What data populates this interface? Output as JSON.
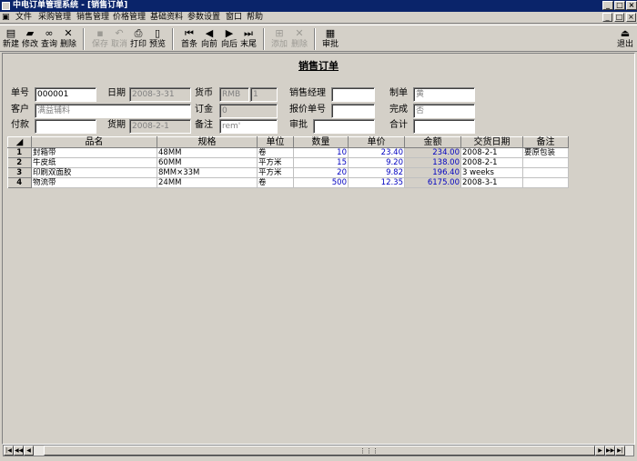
{
  "window": {
    "title": "中电订单管理系统 - [销售订单]",
    "minimize": "_",
    "restore": "□",
    "close": "×"
  },
  "mdi": {
    "minimize": "_",
    "restore": "□",
    "close": "×"
  },
  "menu": [
    "文件",
    "采购管理",
    "销售管理",
    "价格管理",
    "基础资料",
    "参数设置",
    "窗口",
    "帮助"
  ],
  "toolbar": {
    "new": "新建",
    "edit": "修改",
    "query": "查询",
    "delete": "删除",
    "save": "保存",
    "cancel": "取消",
    "print": "打印",
    "preview": "预览",
    "first": "首条",
    "prev": "向前",
    "next": "向后",
    "last": "末尾",
    "add": "添加",
    "remove": "删除",
    "approve": "审批",
    "exit": "退出"
  },
  "form": {
    "title": "销售订单",
    "order_no_label": "单号",
    "order_no": "000001",
    "date_label": "日期",
    "date": "2008-3-31",
    "currency_label": "货币",
    "currency": "RMB",
    "rate": "1",
    "manager_label": "销售经理",
    "manager": "",
    "maker_label": "制单",
    "maker": "黄",
    "customer_label": "客户",
    "customer": "满益辅料",
    "deposit_label": "订金",
    "deposit": "0",
    "quote_no_label": "报价单号",
    "quote_no": "",
    "done_label": "完成",
    "done": "否",
    "payment_label": "付款",
    "payment": "",
    "delivery_label": "货期",
    "delivery": "2008-2-1",
    "remark_label": "备注",
    "remark": "rem'",
    "approval_label": "审批",
    "approval": "",
    "total_label": "合计",
    "total": ""
  },
  "table": {
    "columns": [
      "品名",
      "规格",
      "单位",
      "数量",
      "单价",
      "金额",
      "交货日期",
      "备注"
    ],
    "rows": [
      [
        "1",
        "封箱带",
        "48MM",
        "卷",
        "10",
        "23.40",
        "234.00",
        "2008-2-1",
        "要原包装"
      ],
      [
        "2",
        "牛皮纸",
        "60MM",
        "平方米",
        "15",
        "9.20",
        "138.00",
        "2008-2-1",
        ""
      ],
      [
        "3",
        "印刷双面胶",
        "8MM×33M",
        "平方米",
        "20",
        "9.82",
        "196.40",
        "3 weeks",
        ""
      ],
      [
        "4",
        "物流带",
        "24MM",
        "卷",
        "500",
        "12.35",
        "6175.00",
        "2008-3-1",
        ""
      ]
    ]
  }
}
